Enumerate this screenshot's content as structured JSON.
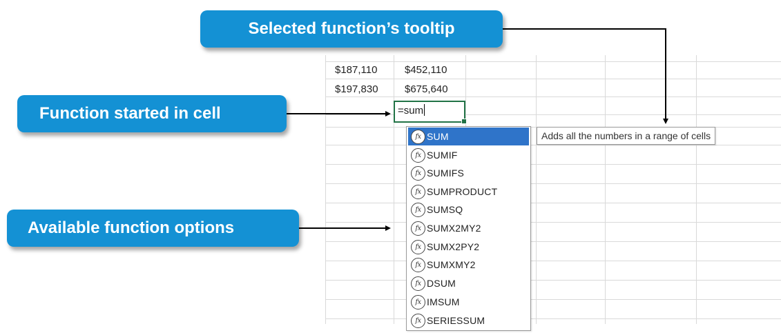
{
  "sheet": {
    "rows": [
      {
        "col_a": "$187,110",
        "col_b": "$452,110"
      },
      {
        "col_a": "$197,830",
        "col_b": "$675,640"
      }
    ],
    "active_cell_entry": "=sum"
  },
  "autocomplete": {
    "icon": "fx-function-icon",
    "icon_glyph": "fx",
    "selected": "SUM",
    "functions": [
      "SUM",
      "SUMIF",
      "SUMIFS",
      "SUMPRODUCT",
      "SUMSQ",
      "SUMX2MY2",
      "SUMX2PY2",
      "SUMXMY2",
      "DSUM",
      "IMSUM",
      "SERIESSUM"
    ]
  },
  "tooltip": {
    "text": "Adds all the numbers in a range of cells"
  },
  "callouts": {
    "selected_tooltip": "Selected function’s  tooltip",
    "function_started": "Function  started  in cell",
    "available_options": "Available  function  options"
  },
  "colors": {
    "callout_bg": "#1491d4",
    "selection_bg": "#2f74c9",
    "active_cell_border": "#217346",
    "gridline": "#d9d9d9"
  }
}
